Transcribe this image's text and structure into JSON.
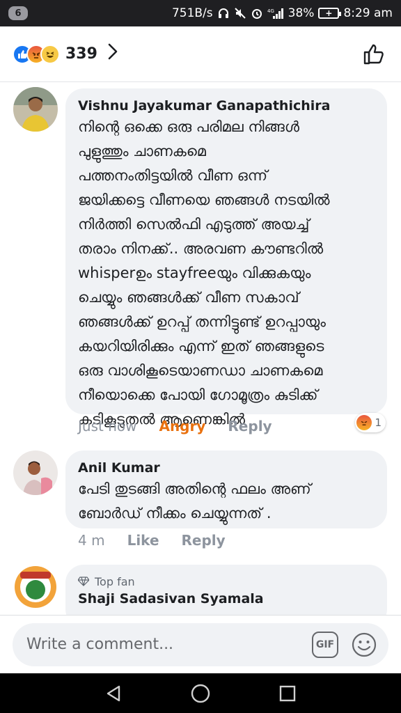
{
  "status_bar": {
    "notification_count": "6",
    "network_speed": "751B/s",
    "network_type": "4G",
    "battery_percent": "38%",
    "time": "8:29 am"
  },
  "reactions_header": {
    "reaction_icons": [
      "like-icon",
      "angry-icon",
      "haha-icon"
    ],
    "count": "339"
  },
  "comments": [
    {
      "author": "Vishnu Jayakumar Ganapathichira",
      "lines": [
        "നിന്റെ ഒക്കെ ഒരു പരിമല നിങ്ങൾ",
        "പുളുത്തും ചാണകമെ",
        "പത്തനംതിട്ടയിൽ വീണ ഒന്ന്",
        "ജയിക്കട്ടെ വീണയെ ഞങ്ങൾ നടയിൽ",
        "നിർത്തി സെൽഫി എടുത്ത് അയച്ച്",
        "തരാം നിനക്ക്.. അരവണ കൗണ്ടറിൽ",
        "whisperഉം  stayfreeയും വിക്കുകയും",
        "ചെയ്യും ഞങ്ങൾക്ക് വീണ സകാവ്",
        "ഞങ്ങൾക്ക് ഉറപ്പ് തന്നിട്ടുണ്ട് ഉറപ്പായും",
        "കയറിയിരിക്കും എന്ന് ഇത് ഞങ്ങളുടെ",
        "ഒരു വാശികൂടെയാണഡാ ചാണകമെ",
        "നീയൊക്കെ പോയി ഗോമൂത്രം കുടിക്ക്",
        "കടികൂടുതൽ ആണെങ്കിൽ"
      ],
      "timestamp": "Just now",
      "reaction_label": "Angry",
      "reply_label": "Reply",
      "reaction_count": "1"
    },
    {
      "author": "Anil Kumar",
      "lines": [
        "പേടി തുടങ്ങി അതിന്റെ ഫലം അണ്",
        "ബോർഡ് നീക്കം ചെയ്യുന്നത് ."
      ],
      "timestamp": "4 m",
      "like_label": "Like",
      "reply_label": "Reply"
    },
    {
      "badge": "Top fan",
      "author": "Shaji Sadasivan Syamala"
    }
  ],
  "composer": {
    "placeholder": "Write a comment...",
    "gif_label": "GIF"
  },
  "colors": {
    "facebook_blue": "#1877f2",
    "angry_orange": "#e9710f",
    "bubble_bg": "#f0f2f5",
    "status_bar_bg": "#1f1f22"
  }
}
